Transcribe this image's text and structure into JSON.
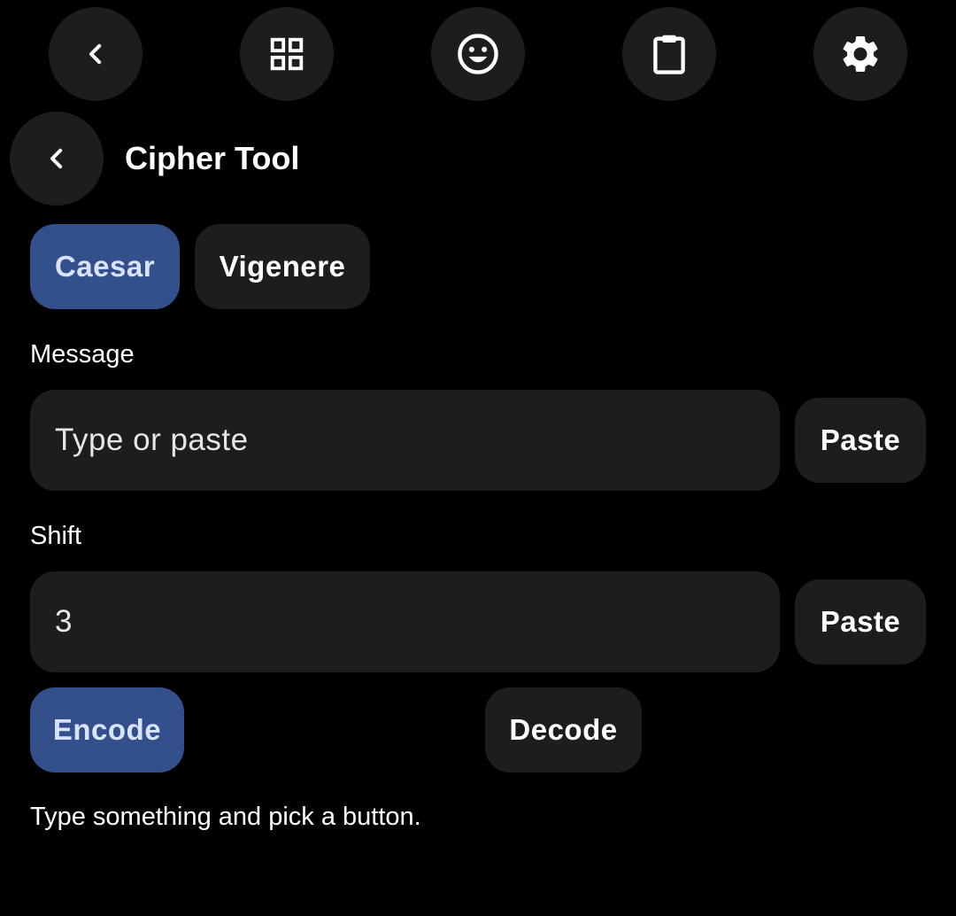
{
  "toolbar": {
    "items": [
      {
        "name": "back",
        "icon": "chevron-left-icon"
      },
      {
        "name": "apps",
        "icon": "grid-icon"
      },
      {
        "name": "emoji",
        "icon": "smiley-icon"
      },
      {
        "name": "clipboard",
        "icon": "clipboard-icon"
      },
      {
        "name": "settings",
        "icon": "gear-icon"
      }
    ]
  },
  "header": {
    "back_icon": "chevron-left-icon",
    "title": "Cipher Tool"
  },
  "cipher_tabs": [
    {
      "label": "Caesar",
      "selected": true
    },
    {
      "label": "Vigenere",
      "selected": false
    }
  ],
  "message": {
    "label": "Message",
    "placeholder": "Type or paste",
    "value": "",
    "paste_label": "Paste"
  },
  "shift": {
    "label": "Shift",
    "value": "3",
    "paste_label": "Paste"
  },
  "actions": {
    "encode_label": "Encode",
    "decode_label": "Decode"
  },
  "status": "Type something and pick a button.",
  "colors": {
    "background": "#000000",
    "surface": "#1d1d1d",
    "accent": "#34508c",
    "accent_text": "#d9e2ff",
    "text": "#ffffff"
  }
}
